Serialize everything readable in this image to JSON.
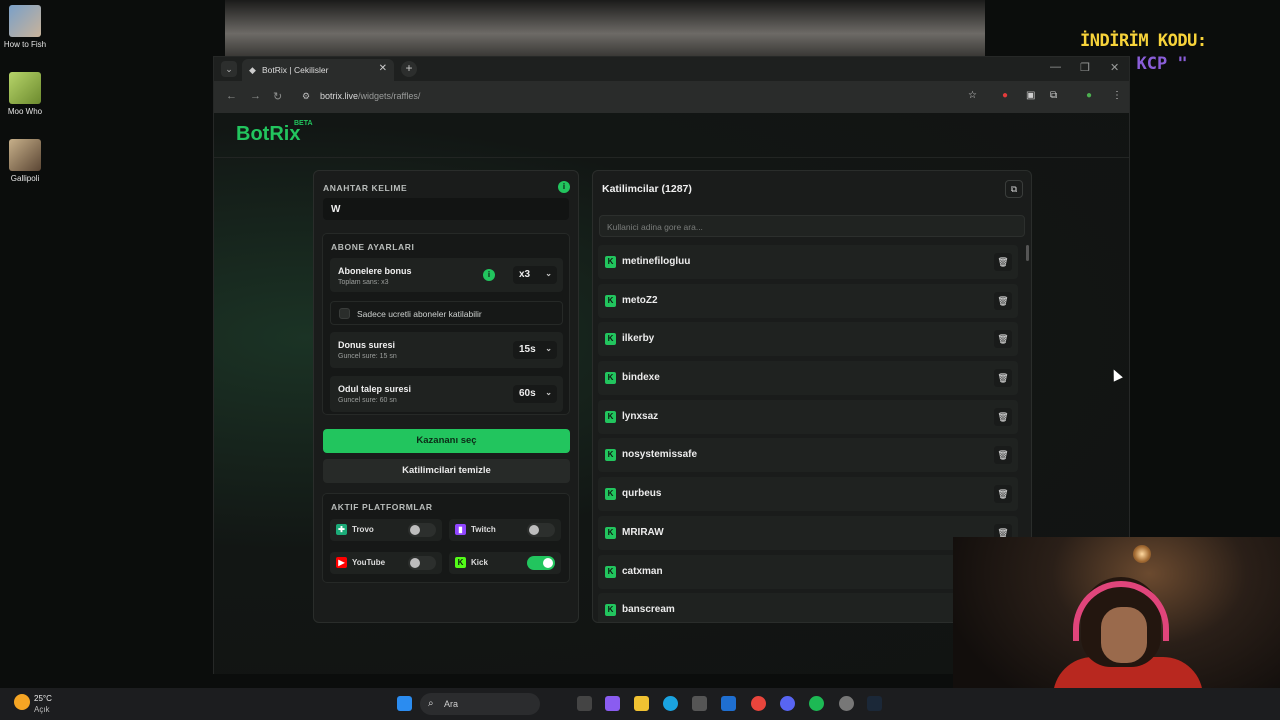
{
  "desktop": {
    "icons": [
      "How to Fish",
      "Moo Who",
      "Gallipoli"
    ],
    "promo_line1": "İNDİRİM KODU:",
    "promo_line2": "\" KCP \""
  },
  "browser": {
    "tab_title": "BotRix | Cekilisler",
    "url_host": "botrix.live",
    "url_path": "/widgets/raffles/"
  },
  "app": {
    "logo": "BotRix",
    "logo_badge": "BETA",
    "accent": "#22c55e"
  },
  "settings": {
    "keyword_label": "ANAHTAR KELIME",
    "keyword_value": "W",
    "subscriber_section": "ABONE AYARLARI",
    "sub_bonus_title": "Abonelere bonus",
    "sub_bonus_sub": "Toplam sans: x3",
    "sub_bonus_value": "x3",
    "paid_only_label": "Sadece ucretli aboneler katilabilir",
    "return_title": "Donus suresi",
    "return_sub": "Guncel sure: 15 sn",
    "return_value": "15s",
    "claim_title": "Odul talep suresi",
    "claim_sub": "Guncel sure: 60 sn",
    "claim_value": "60s",
    "pick_winner": "Kazananı seç",
    "clear_participants": "Katilimcilari temizle",
    "platforms_label": "AKTIF PLATFORMLAR",
    "platforms": [
      {
        "name": "Trovo",
        "enabled": false,
        "color": "#1bab78"
      },
      {
        "name": "Twitch",
        "enabled": false,
        "color": "#9146ff"
      },
      {
        "name": "YouTube",
        "enabled": false,
        "color": "#ff0000"
      },
      {
        "name": "Kick",
        "enabled": true,
        "color": "#53fc18"
      }
    ]
  },
  "participants": {
    "header": "Katilimcilar (1287)",
    "search_placeholder": "Kullanici adina gore ara...",
    "list": [
      "metinefilogluu",
      "metoZ2",
      "ilkerby",
      "bindexe",
      "lynxsaz",
      "nosystemissafe",
      "qurbeus",
      "MRIRAW",
      "catxman",
      "banscream"
    ]
  },
  "taskbar": {
    "temp": "25°C",
    "condition": "Açık",
    "search": "Ara"
  }
}
